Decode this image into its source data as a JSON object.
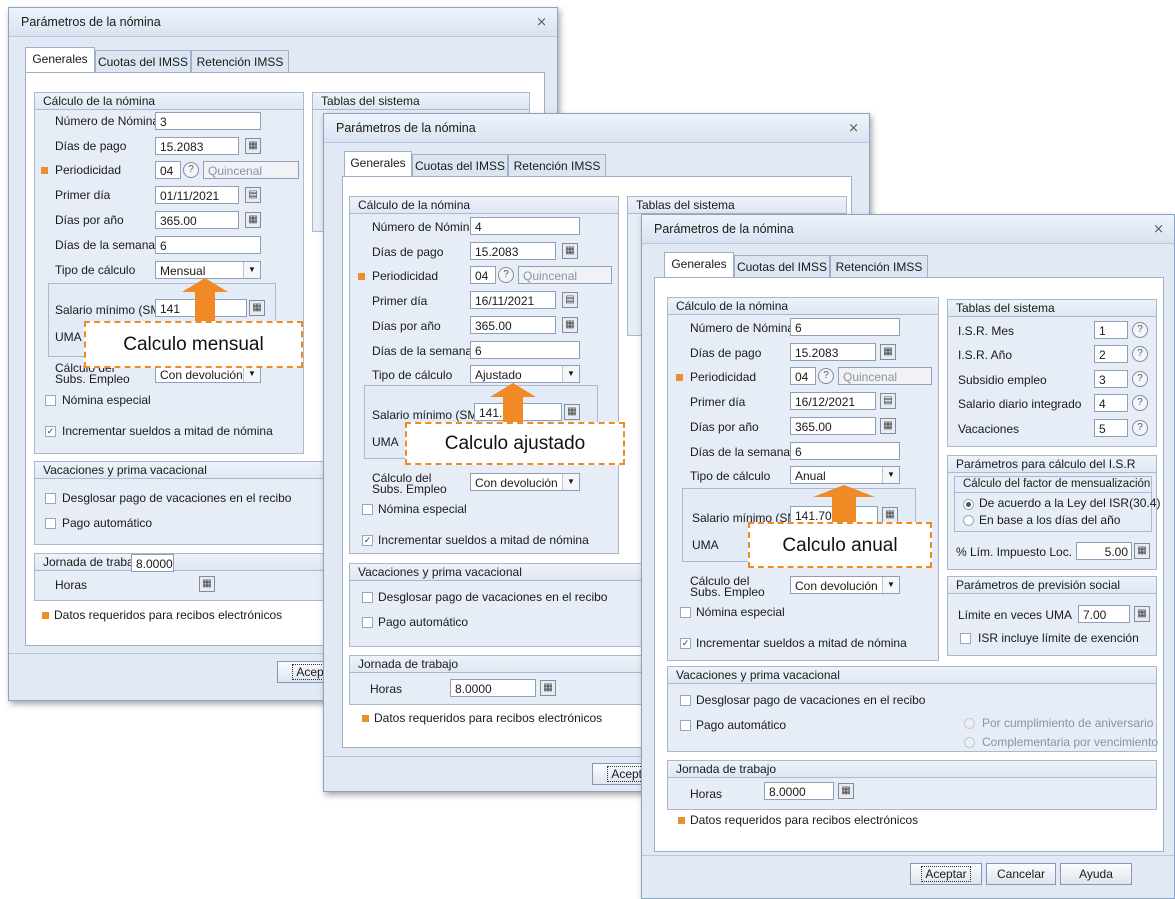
{
  "dialog_title": "Parámetros de la nómina",
  "close_glyph": "⨯",
  "tabs": [
    "Generales",
    "Cuotas del IMSS",
    "Retención IMSS"
  ],
  "calculo": {
    "title": "Cálculo de la nómina",
    "numero_label": "Número de Nómina",
    "dias_pago_label": "Días de pago",
    "dias_pago": "15.2083",
    "periodicidad_label": "Periodicidad",
    "periodicidad_code": "04",
    "periodicidad_name": "Quincenal",
    "primer_dia_label": "Primer día",
    "dias_anio_label": "Días por año",
    "dias_anio": "365.00",
    "dias_semana_label": "Días de la semana",
    "dias_semana": "6",
    "tipo_label": "Tipo de cálculo",
    "salario_label": "Salario mínimo (SM)",
    "uma_label": "UMA",
    "subs_label": "Cálculo del Subs. Empleo",
    "subs_value": "Con devolución",
    "nomina_especial": "Nómina especial",
    "incrementar": "Incrementar sueldos a mitad de nómina"
  },
  "tablas_title": "Tablas del sistema",
  "vacaciones": {
    "title": "Vacaciones y prima vacacional",
    "desglosar": "Desglosar pago de vacaciones en el recibo",
    "pago_auto": "Pago automático",
    "aniversario": "Por cumplimiento de aniversario",
    "complementaria": "Complementaria por vencimiento"
  },
  "jornada": {
    "title": "Jornada de trabajo",
    "horas_label": "Horas",
    "horas": "8.0000"
  },
  "requeridos": "Datos requeridos para recibos electrónicos",
  "buttons": {
    "aceptar": "Aceptar",
    "cancelar": "Cancelar",
    "ayuda": "Ayuda"
  },
  "windows": [
    {
      "numero": "3",
      "primer_dia": "01/11/2021",
      "tipo": "Mensual",
      "salario": "141",
      "callout": "Calculo mensual",
      "aceptar_partial": "Acepta"
    },
    {
      "numero": "4",
      "primer_dia": "16/11/2021",
      "tipo": "Ajustado",
      "salario": "141.",
      "callout": "Calculo ajustado",
      "aceptar_partial": "Acepta"
    },
    {
      "numero": "6",
      "primer_dia": "16/12/2021",
      "tipo": "Anual",
      "salario": "141.70",
      "callout": "Calculo anual"
    }
  ],
  "tablas": [
    {
      "label": "I.S.R. Mes",
      "value": "1"
    },
    {
      "label": "I.S.R. Año",
      "value": "2"
    },
    {
      "label": "Subsidio empleo",
      "value": "3"
    },
    {
      "label": "Salario diario integrado",
      "value": "4"
    },
    {
      "label": "Vacaciones",
      "value": "5"
    }
  ],
  "isr": {
    "title": "Parámetros para cálculo del I.S.R",
    "factor_title": "Cálculo del factor de mensualización",
    "opt1": "De acuerdo a la Ley del ISR(30.4)",
    "opt2": "En base a los días del año",
    "lim_label": "% Lím. Impuesto Loc.",
    "lim_value": "5.00"
  },
  "prevision": {
    "title": "Parámetros de previsión social",
    "limite_label": "Límite en veces UMA",
    "limite_value": "7.00",
    "isr_incluye": "ISR incluye límite de exención"
  },
  "colors": {
    "accent_orange": "#f08a24",
    "required_square": "#e8912b"
  }
}
